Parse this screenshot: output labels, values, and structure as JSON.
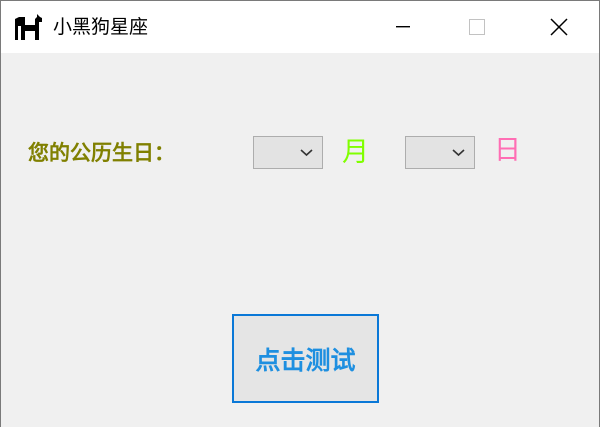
{
  "window": {
    "title": "小黑狗星座",
    "app_icon": "black-dog-icon",
    "controls": {
      "minimize_icon": "minimize-icon",
      "maximize_icon": "maximize-icon",
      "close_icon": "close-icon"
    }
  },
  "form": {
    "birthday_label": "您的公历生日：",
    "month_select": {
      "value": "",
      "unit_label": "月"
    },
    "day_select": {
      "value": "",
      "unit_label": "日"
    },
    "test_button_label": "点击测试"
  },
  "colors": {
    "label_olive": "#808000",
    "month_green": "#80ff00",
    "day_pink": "#ff6eb4",
    "button_text_blue": "#1e8fe0",
    "button_border_blue": "#0a78d7"
  }
}
